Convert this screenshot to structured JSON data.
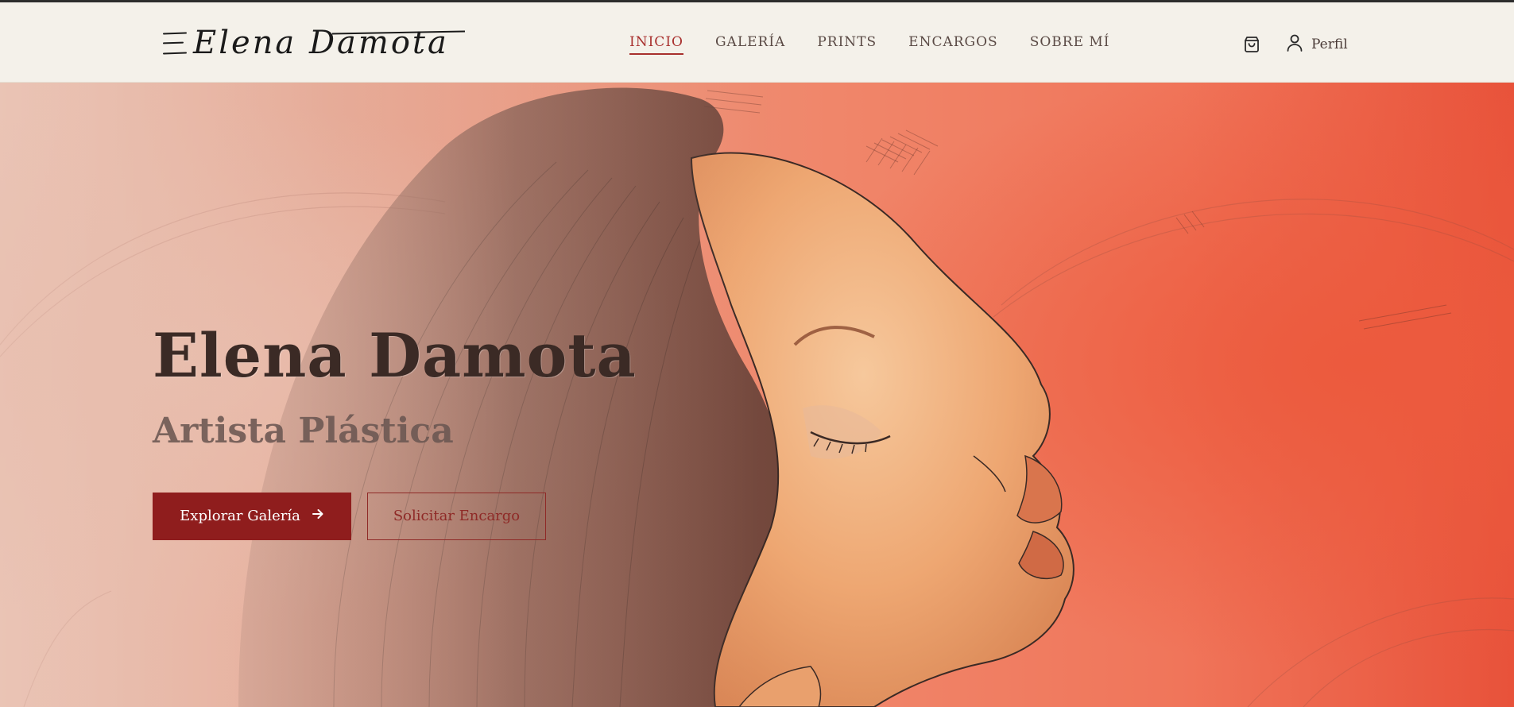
{
  "header": {
    "logo_text": "Elena Damota",
    "nav": [
      {
        "label": "INICIO",
        "active": true
      },
      {
        "label": "GALERÍA",
        "active": false
      },
      {
        "label": "PRINTS",
        "active": false
      },
      {
        "label": "ENCARGOS",
        "active": false
      },
      {
        "label": "SOBRE MÍ",
        "active": false
      }
    ],
    "cart_icon": "shopping-bag-icon",
    "profile_icon": "user-icon",
    "profile_label": "Perfil"
  },
  "hero": {
    "title": "Elena Damota",
    "subtitle": "Artista Plástica",
    "primary_button": "Explorar Galería",
    "primary_button_icon": "arrow-right-icon",
    "secondary_button": "Solicitar Encargo"
  },
  "colors": {
    "accent": "#a8302e",
    "button_primary": "#8f1d1d",
    "header_bg": "#f4f1ea"
  }
}
